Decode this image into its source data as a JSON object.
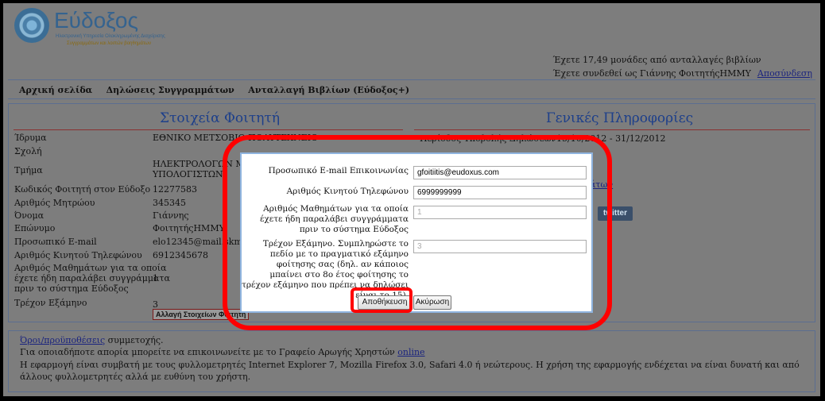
{
  "logo": {
    "name": "Εύδοξος",
    "sub1": "Ηλεκτρονική Υπηρεσία Ολοκληρωμένης Διαχείρισης",
    "sub2": "Συγγραμμάτων και λοιπών βοηθημάτων"
  },
  "user": {
    "credits": "Έχετε 17,49 μονάδες από ανταλλαγές βιβλίων",
    "logged_in": "Έχετε συνδεθεί ως Γιάννης ΦοιτητήςΗΜΜΥ",
    "logout": "Αποσύνδεση"
  },
  "nav": [
    "Αρχική σελίδα",
    "Δηλώσεις Συγγραμμάτων",
    "Ανταλλαγή Βιβλίων (Εύδοξος+)"
  ],
  "student": {
    "title": "Στοιχεία Φοιτητή",
    "rows": [
      {
        "label": "Ίδρυμα",
        "value": "ΕΘΝΙΚΟ ΜΕΤΣΟΒΙΟ ΠΟΛΥΤΕΧΝΕΙΟ"
      },
      {
        "label": "Σχολή",
        "value": ""
      },
      {
        "label": "Τμήμα",
        "value": "ΗΛΕΚΤΡΟΛΟΓΩΝ ΜΗ"
      },
      {
        "label": "Κωδικός Φοιτητή στον Εύδοξο",
        "value": "12277583"
      },
      {
        "label": "Αριθμός Μητρώου",
        "value": "345345"
      },
      {
        "label": "Όνομα",
        "value": "Γιάννης"
      },
      {
        "label": "Επώνυμο",
        "value": "ΦοιτητήςΗΜΜΥ"
      },
      {
        "label": "Προσωπικό E-mail",
        "value": "elo12345@mail.skmmy"
      },
      {
        "label": "Αριθμός Κινητού Τηλεφώνου",
        "value": "6912345678"
      },
      {
        "label": "Αριθμός Μαθημάτων για τα οποία",
        "value": ""
      },
      {
        "label": "έχετε ήδη παραλάβει συγγράμματα",
        "value": "1"
      },
      {
        "label": "πριν το σύστημα Εύδοξος",
        "value": ""
      },
      {
        "label": "Τρέχον Εξάμηνο",
        "value": "3"
      }
    ],
    "dept_line2": "ΥΠΟΛΟΓΙΣΤΩΝ",
    "change_button": "Αλλαγή Στοιχείων Φοιτητή"
  },
  "general": {
    "title": "Γενικές Πληροφορίες",
    "period_label": "Περίοδος Υποβολής Δηλώσεων",
    "period_value": "15/10/2012 - 31/12/2012",
    "link_fragment": "άτων",
    "twitter": "twitter"
  },
  "dialog": {
    "email_label": "Προσωπικό E-mail Επικοινωνίας",
    "email_value": "gfoitiitis@eudoxus.com",
    "phone_label": "Αριθμός Κινητού Τηλεφώνου",
    "phone_value": "6999999999",
    "courses_label": "Αριθμός Μαθημάτων για τα οποία έχετε ήδη παραλάβει συγγράμματα πριν το σύστημα Εύδοξος",
    "courses_value": "1",
    "semester_label": "Τρέχον Εξάμηνο. Συμπληρώστε το πεδίο με το πραγματικό εξάμηνο φοίτησης σας (δηλ. αν κάποιος μπαίνει στο 8ο έτος φοίτησης το τρέχον εξάμηνο που πρέπει να δηλώσει είναι το 15).",
    "semester_value": "3",
    "save": "Αποθήκευση",
    "cancel": "Ακύρωση"
  },
  "footer": {
    "terms_link": "Όροι/προϋποθέσεις",
    "terms_text": " συμμετοχής.",
    "contact_text": "Για οποιαδήποτε απορία μπορείτε να επικοινωνείτε με το Γραφείο Αρωγής Χρηστών ",
    "contact_link": "online",
    "compat": "Η εφαρμογή είναι συμβατή με τους φυλλομετρητές Internet Explorer 7, Mozilla Firefox 3.0, Safari 4.0 ή νεώτερους. Η χρήση της εφαρμογής ενδέχεται να είναι δυνατή και από άλλους φυλλομετρητές αλλά με ευθύνη του χρήστη."
  }
}
